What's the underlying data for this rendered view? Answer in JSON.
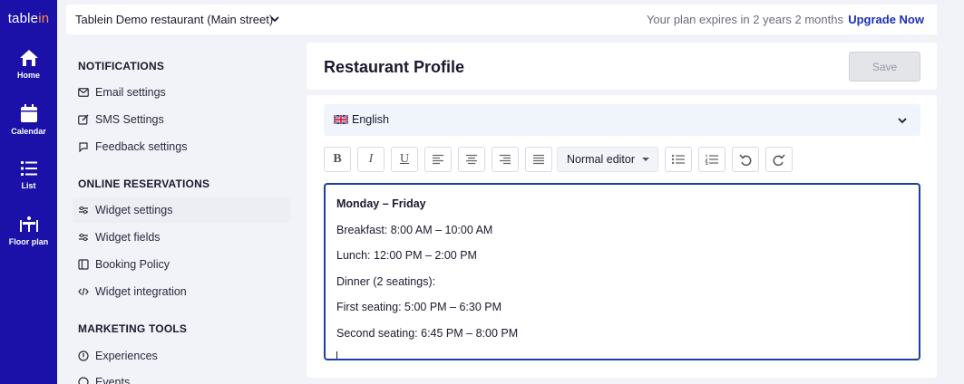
{
  "app": {
    "logo_text": "table",
    "logo_accent": "in"
  },
  "rail": [
    {
      "label": "Home",
      "icon": "home-icon"
    },
    {
      "label": "Calendar",
      "icon": "calendar-icon"
    },
    {
      "label": "List",
      "icon": "list-icon"
    },
    {
      "label": "Floor plan",
      "icon": "floor-plan-icon"
    }
  ],
  "topbar": {
    "venue": "Tablein Demo restaurant (Main street)",
    "plan_notice": "Your plan expires in 2 years 2 months",
    "upgrade": "Upgrade Now"
  },
  "menu": {
    "sections": [
      {
        "title": "NOTIFICATIONS",
        "items": [
          "Email settings",
          "SMS Settings",
          "Feedback settings"
        ]
      },
      {
        "title": "ONLINE RESERVATIONS",
        "items": [
          "Widget settings",
          "Widget fields",
          "Booking Policy",
          "Widget integration"
        ]
      },
      {
        "title": "MARKETING TOOLS",
        "items": [
          "Experiences",
          "Events"
        ]
      }
    ],
    "active": "Widget settings"
  },
  "page": {
    "title": "Restaurant Profile",
    "save_label": "Save"
  },
  "editor": {
    "language": "English",
    "toolbar": {
      "bold": "B",
      "italic": "I",
      "underline": "U",
      "editor_mode": "Normal editor"
    },
    "paragraphs": [
      {
        "text": "Monday – Friday",
        "bold": true
      },
      {
        "text": "Breakfast: 8:00 AM – 10:00 AM",
        "bold": false
      },
      {
        "text": "Lunch: 12:00 PM – 2:00 PM",
        "bold": false
      },
      {
        "text": "Dinner (2 seatings):",
        "bold": false
      },
      {
        "text": "First seating: 5:00 PM – 6:30 PM",
        "bold": false
      },
      {
        "text": "Second seating: 6:45 PM – 8:00 PM",
        "bold": false
      }
    ]
  },
  "colors": {
    "rail": "#1b11a8",
    "accent": "#1b2fb8",
    "logo_accent": "#ff8a3d"
  }
}
